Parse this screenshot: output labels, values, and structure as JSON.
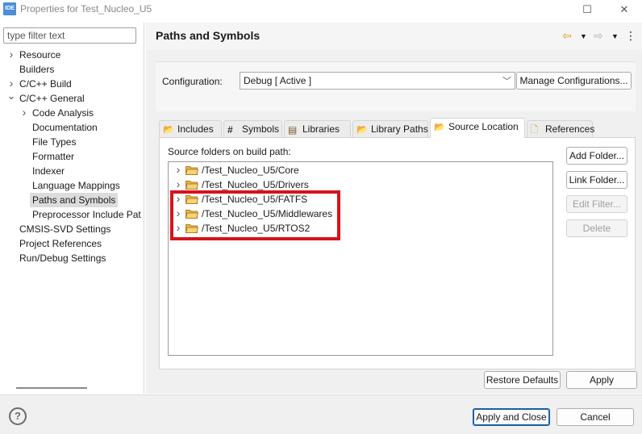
{
  "window": {
    "app_icon_text": "IDE",
    "title": "Properties for Test_Nucleo_U5",
    "maximize_glyph": "☐",
    "close_glyph": "✕"
  },
  "left": {
    "filter_placeholder": "type filter text",
    "tree": [
      {
        "label": "Resource",
        "expander": "chevron-right",
        "depth": 0
      },
      {
        "label": "Builders",
        "expander": "none",
        "depth": 0
      },
      {
        "label": "C/C++ Build",
        "expander": "chevron-right",
        "depth": 0
      },
      {
        "label": "C/C++ General",
        "expander": "chevron-down",
        "depth": 0
      },
      {
        "label": "Code Analysis",
        "expander": "chevron-right",
        "depth": 1
      },
      {
        "label": "Documentation",
        "expander": "none",
        "depth": 1
      },
      {
        "label": "File Types",
        "expander": "none",
        "depth": 1
      },
      {
        "label": "Formatter",
        "expander": "none",
        "depth": 1
      },
      {
        "label": "Indexer",
        "expander": "none",
        "depth": 1
      },
      {
        "label": "Language Mappings",
        "expander": "none",
        "depth": 1
      },
      {
        "label": "Paths and Symbols",
        "expander": "none",
        "depth": 1,
        "selected": true
      },
      {
        "label": "Preprocessor Include Pat",
        "expander": "none",
        "depth": 1
      },
      {
        "label": "CMSIS-SVD Settings",
        "expander": "none",
        "depth": 0
      },
      {
        "label": "Project References",
        "expander": "none",
        "depth": 0
      },
      {
        "label": "Run/Debug Settings",
        "expander": "none",
        "depth": 0
      }
    ]
  },
  "main": {
    "title": "Paths and Symbols",
    "config_label": "Configuration:",
    "config_value": "Debug  [ Active ]",
    "manage_button": "Manage Configurations...",
    "tabs": [
      {
        "label": "Includes",
        "icon": "includes-icon",
        "glyph": "📂"
      },
      {
        "label": "Symbols",
        "icon": "hash-icon",
        "glyph": "#"
      },
      {
        "label": "Libraries",
        "icon": "libraries-icon",
        "glyph": "▤"
      },
      {
        "label": "Library Paths",
        "icon": "library-paths-icon",
        "glyph": "📂"
      },
      {
        "label": "Source Location",
        "icon": "source-location-icon",
        "glyph": "📂",
        "active": true
      },
      {
        "label": "References",
        "icon": "references-icon",
        "glyph": "🗋"
      }
    ],
    "section_label": "Source folders on build path:",
    "source_folders": [
      "/Test_Nucleo_U5/Core",
      "/Test_Nucleo_U5/Drivers",
      "/Test_Nucleo_U5/FATFS",
      "/Test_Nucleo_U5/Middlewares",
      "/Test_Nucleo_U5/RTOS2"
    ],
    "highlighted_items": [
      "/Test_Nucleo_U5/FATFS",
      "/Test_Nucleo_U5/Middlewares",
      "/Test_Nucleo_U5/RTOS2"
    ],
    "highlight_color": "#d8121c",
    "side_buttons": {
      "add_folder": "Add Folder...",
      "link_folder": "Link Folder...",
      "edit_filter": "Edit Filter...",
      "delete": "Delete"
    },
    "restore_defaults": "Restore Defaults",
    "apply": "Apply"
  },
  "footer": {
    "help_glyph": "?",
    "apply_close": "Apply and Close",
    "cancel": "Cancel"
  },
  "colors": {
    "accent": "#1a5fa8",
    "folder": "#e8b84a",
    "nav_back": "#d9a21b"
  }
}
